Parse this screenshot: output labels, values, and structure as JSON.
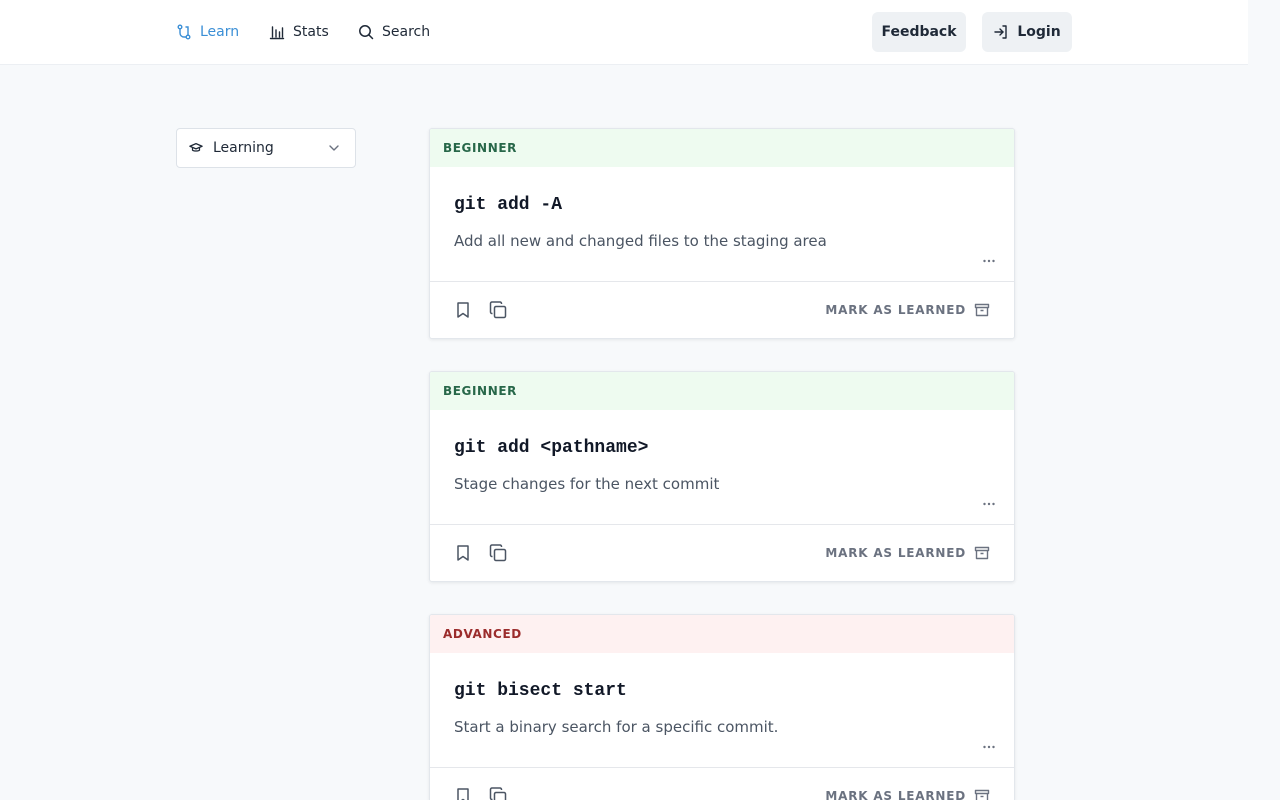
{
  "nav": {
    "learn": "Learn",
    "stats": "Stats",
    "search": "Search"
  },
  "header_buttons": {
    "feedback": "Feedback",
    "login": "Login"
  },
  "filter": {
    "selected": "Learning",
    "icon": "graduation-cap-icon"
  },
  "colors": {
    "accent": "#3b8fd6",
    "beginner_bg": "#eefbf0",
    "beginner_text": "#276749",
    "advanced_bg": "#fef1f1",
    "advanced_text": "#9b2c2c"
  },
  "cards": [
    {
      "level": "BEGINNER",
      "command": "git add -A",
      "description": "Add all new and changed files to the staging area",
      "action": "MARK AS LEARNED"
    },
    {
      "level": "BEGINNER",
      "command": "git add <pathname>",
      "description": "Stage changes for the next commit",
      "action": "MARK AS LEARNED"
    },
    {
      "level": "ADVANCED",
      "command": "git bisect start",
      "description": "Start a binary search for a specific commit.",
      "action": "MARK AS LEARNED"
    }
  ]
}
